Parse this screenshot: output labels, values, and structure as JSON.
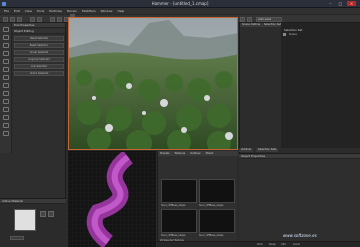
{
  "window": {
    "title": "Hammer - [untitled_1.cmap]",
    "controls": [
      "–",
      "□",
      "✕"
    ]
  },
  "menubar": {
    "items": [
      "File",
      "Edit",
      "View",
      "Tools",
      "Particles",
      "Terrain",
      "Modifiers",
      "Window",
      "Help"
    ]
  },
  "toolbar": {
    "render_settings_label": "Render Settings",
    "view_settings_label": "View Settings",
    "auto_save_label": "Auto-save"
  },
  "left_panel": {
    "title": "Tool Properties",
    "section": "Object Editing",
    "buttons": [
      "Reset Selected",
      "Reset Selection",
      "Group Selected",
      "Ungroup Selected",
      "Link Selected",
      "Unlink Selected"
    ]
  },
  "material_panel": {
    "title": "Active Material",
    "swatch_color": "#e0e0e0"
  },
  "viewport": {
    "sky_color": "#8f9aa0",
    "accent_color": "#c66432"
  },
  "browser": {
    "tabs": [
      "Presets",
      "Textures",
      "Outliner",
      "Mixed"
    ],
    "status": "26 Selected Textures",
    "assets": [
      {
        "label": "fsoul_cliffBase_shape"
      },
      {
        "label": "fsoul_cliffBase_shape"
      },
      {
        "label": "fsoul_cliffBase_shape"
      },
      {
        "label": "fsoul_cliffBase_shape"
      }
    ]
  },
  "right_panel": {
    "tabs": [
      "Scene Outline",
      "Selection Sets"
    ],
    "header": "Selection Set",
    "item": "Scene",
    "bottom_tabs": [
      "Outliner",
      "Selection Sets"
    ],
    "props_title": "Object Properties"
  },
  "statusbar": {
    "items": [
      "Grid",
      "Snap",
      "Info",
      "Local"
    ]
  },
  "watermark": "www.softzone.es"
}
